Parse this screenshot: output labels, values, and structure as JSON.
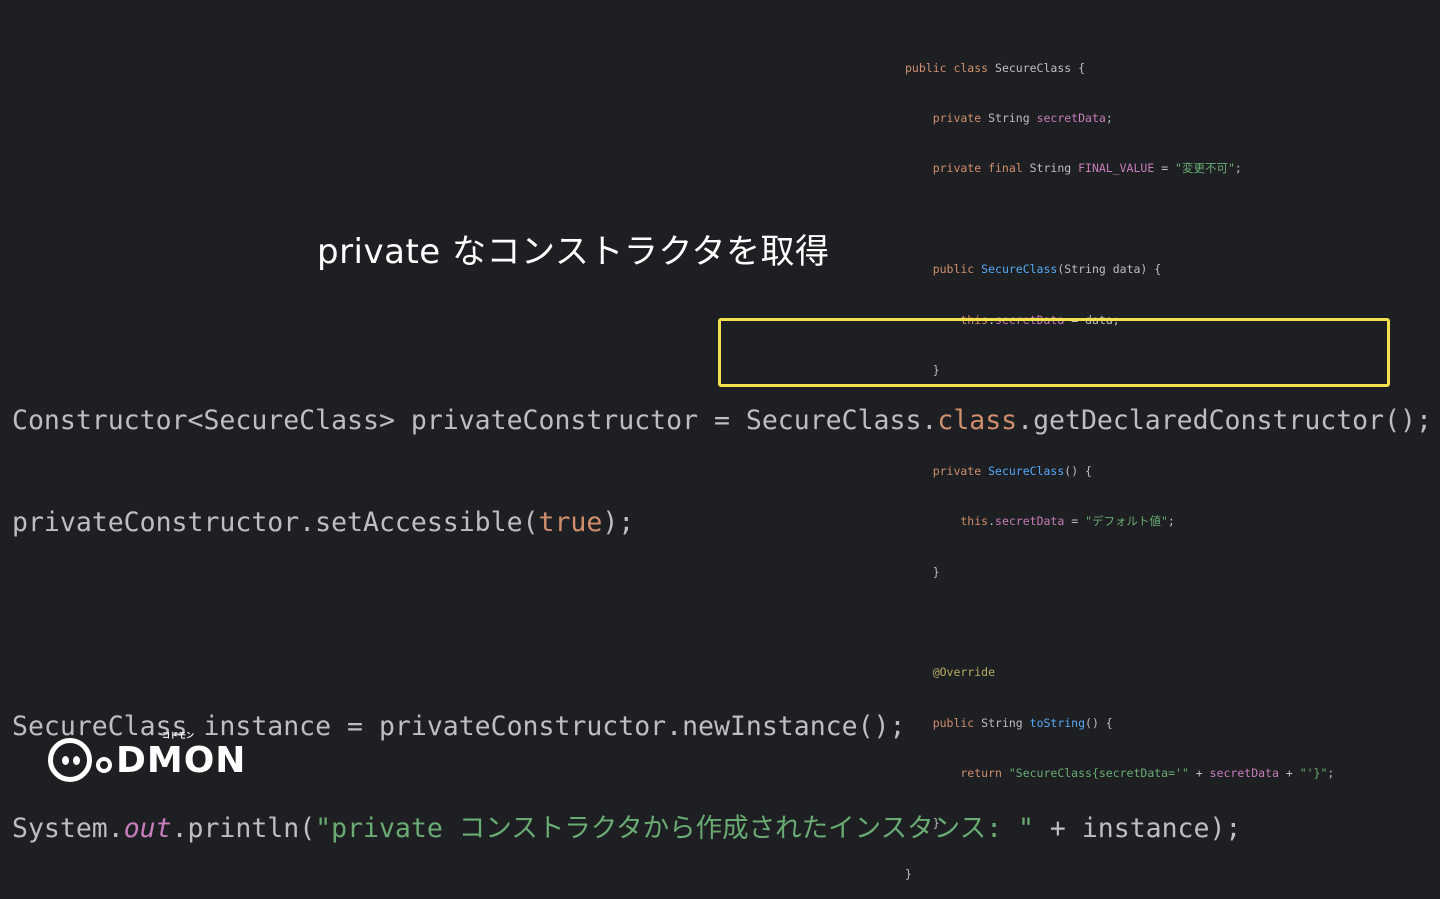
{
  "title": "private なコンストラクタを取得",
  "mini_code": {
    "l1_kw": "public class ",
    "l1_name": "SecureClass {",
    "l2_kw": "    private ",
    "l2_type": "String ",
    "l2_field": "secretData",
    "l2_end": ";",
    "l3_kw": "    private final ",
    "l3_type": "String ",
    "l3_field": "FINAL_VALUE",
    "l3_eq": " = ",
    "l3_str": "\"変更不可\"",
    "l3_end": ";",
    "l5_kw": "    public ",
    "l5_fn": "SecureClass",
    "l5_rest": "(String data) {",
    "l6_kw": "        this",
    "l6_dot": ".",
    "l6_field": "secretData",
    "l6_rest": " = data;",
    "l7": "    }",
    "l9_kw": "    private ",
    "l9_fn": "SecureClass",
    "l9_rest": "() {",
    "l10_kw": "        this",
    "l10_dot": ".",
    "l10_field": "secretData",
    "l10_eq": " = ",
    "l10_str": "\"デフォルト値\"",
    "l10_end": ";",
    "l11": "    }",
    "l13_ann": "    @Override",
    "l14_kw": "    public ",
    "l14_type": "String ",
    "l14_fn": "toString",
    "l14_rest": "() {",
    "l15_kw": "        return ",
    "l15_str1": "\"SecureClass{secretData='\"",
    "l15_plus1": " + ",
    "l15_field": "secretData",
    "l15_plus2": " + ",
    "l15_str2": "\"'}\"",
    "l15_end": ";",
    "l16": "    }",
    "l17": "}"
  },
  "main_code": {
    "l1_a": "Constructor<SecureClass> privateConstructor = SecureClass.",
    "l1_kw": "class",
    "l1_b": ".getDeclaredConstructor();",
    "l2_a": "privateConstructor.setAccessible(",
    "l2_kw": "true",
    "l2_b": ");",
    "l3": "SecureClass instance = privateConstructor.newInstance();",
    "l4_a": "System.",
    "l4_field": "out",
    "l4_b": ".println(",
    "l4_str": "\"private コンストラクタから作成されたインスタンス: \"",
    "l4_c": " + instance);"
  },
  "logo": {
    "text": "DMON",
    "ruby": "コドモン"
  },
  "colors": {
    "background": "#1e1f22",
    "highlight": "#f4e04d",
    "keyword": "#cf8e6d",
    "string": "#6aab73",
    "field": "#c77dbb",
    "function": "#56a8f5",
    "annotation": "#b3ae60"
  }
}
